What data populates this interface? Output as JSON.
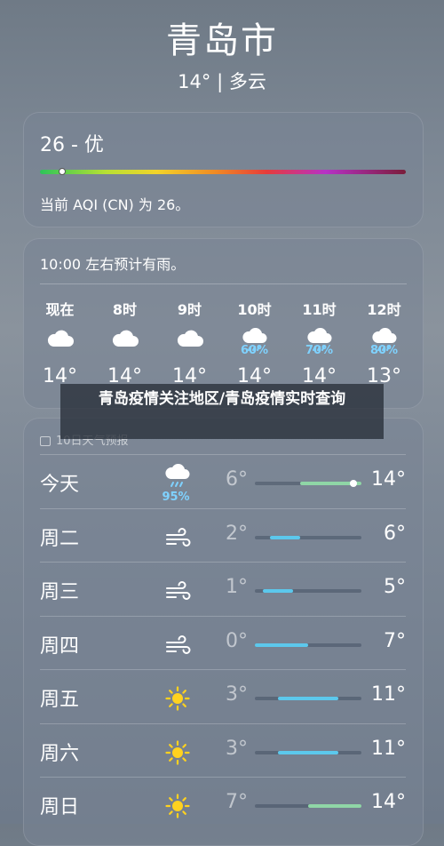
{
  "header": {
    "city": "青岛市",
    "condition": "14° | 多云"
  },
  "aqi": {
    "title": "26 - 优",
    "description": "当前 AQI (CN) 为 26。",
    "value_fraction": 0.05
  },
  "hourly": {
    "note": "10:00 左右预计有雨。",
    "items": [
      {
        "time": "现在",
        "icon": "cloud-icon",
        "precip": "",
        "temp": "14°"
      },
      {
        "time": "8时",
        "icon": "cloud-icon",
        "precip": "",
        "temp": "14°"
      },
      {
        "time": "9时",
        "icon": "cloud-icon",
        "precip": "",
        "temp": "14°"
      },
      {
        "time": "10时",
        "icon": "rain-cloud-icon",
        "precip": "60%",
        "temp": "14°"
      },
      {
        "time": "11时",
        "icon": "rain-cloud-icon",
        "precip": "70%",
        "temp": "14°"
      },
      {
        "time": "12时",
        "icon": "rain-cloud-icon",
        "precip": "80%",
        "temp": "13°"
      }
    ]
  },
  "daily": {
    "header": "10日天气预报",
    "range": [
      0,
      14
    ],
    "items": [
      {
        "day": "今天",
        "icon": "rain-cloud-icon",
        "precip": "95%",
        "low": "6°",
        "high": "14°",
        "lo": 6,
        "hi": 14,
        "color": "#8fd6a6",
        "now": 13
      },
      {
        "day": "周二",
        "icon": "wind-icon",
        "precip": "",
        "low": "2°",
        "high": "6°",
        "lo": 2,
        "hi": 6,
        "color": "#5cc8ec"
      },
      {
        "day": "周三",
        "icon": "wind-icon",
        "precip": "",
        "low": "1°",
        "high": "5°",
        "lo": 1,
        "hi": 5,
        "color": "#5cc8ec"
      },
      {
        "day": "周四",
        "icon": "wind-icon",
        "precip": "",
        "low": "0°",
        "high": "7°",
        "lo": 0,
        "hi": 7,
        "color": "#5cc8ec"
      },
      {
        "day": "周五",
        "icon": "sun-icon",
        "precip": "",
        "low": "3°",
        "high": "11°",
        "lo": 3,
        "hi": 11,
        "color": "#5cc8ec"
      },
      {
        "day": "周六",
        "icon": "sun-icon",
        "precip": "",
        "low": "3°",
        "high": "11°",
        "lo": 3,
        "hi": 11,
        "color": "#5cc8ec"
      },
      {
        "day": "周日",
        "icon": "sun-icon",
        "precip": "",
        "low": "7°",
        "high": "14°",
        "lo": 7,
        "hi": 14,
        "color": "#8fd6a6"
      }
    ]
  },
  "overlay": {
    "title": "青岛疫情关注地区/青岛疫情实时查询"
  }
}
